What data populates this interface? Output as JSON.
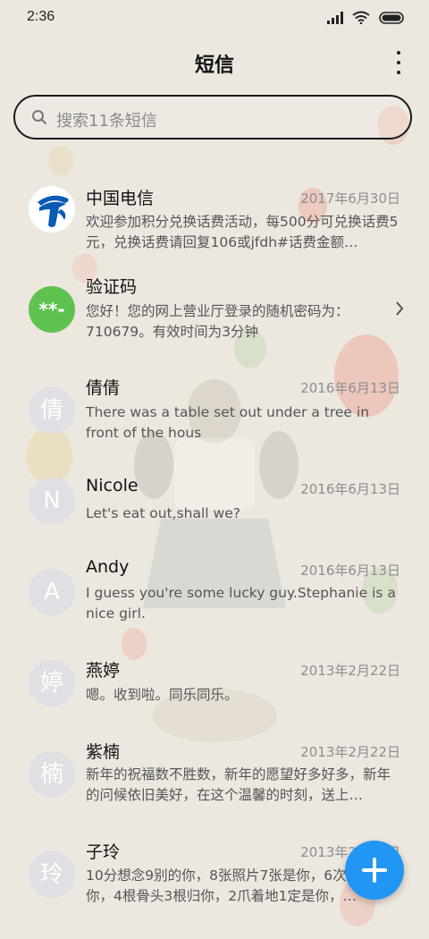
{
  "status_bar": {
    "time": "2:36"
  },
  "header": {
    "title": "短信"
  },
  "search": {
    "placeholder": "搜索11条短信"
  },
  "conversations": [
    {
      "name": "中国电信",
      "date": "2017年6月30日",
      "snippet": "欢迎参加积分兑换话费活动，每500分可兑换话费5元，兑换话费请回复106或jfdh#话费金额…",
      "avatar_type": "logo"
    },
    {
      "name": "验证码",
      "snippet": "您好！您的网上营业厅登录的随机密码为：710679。有效时间为3分钟",
      "avatar_text": "**-",
      "avatar_color": "#5ec24f"
    },
    {
      "name": "倩倩",
      "date": "2016年6月13日",
      "snippet": "There was a table set out under a tree in front of the hous",
      "avatar_text": "倩"
    },
    {
      "name": "Nicole",
      "date": "2016年6月13日",
      "snippet": "Let's eat out,shall we?",
      "avatar_text": "N"
    },
    {
      "name": "Andy",
      "date": "2016年6月13日",
      "snippet": "I guess you're some lucky guy.Stephanie is a nice girl.",
      "avatar_text": "A"
    },
    {
      "name": "燕婷",
      "date": "2013年2月22日",
      "snippet": "嗯。收到啦。同乐同乐。",
      "avatar_text": "婷"
    },
    {
      "name": "紫楠",
      "date": "2013年2月22日",
      "snippet": "新年的祝福数不胜数，新年的愿望好多好多，新年的问候依旧美好，在这个温馨的时刻，送上…",
      "avatar_text": "楠"
    },
    {
      "name": "子玲",
      "date": "2013年2月22日",
      "snippet": "10分想念9别的你，8张照片7张是你，6次…只像你，4根骨头3根归你，2爪着地1定是你，…",
      "avatar_text": "玲"
    }
  ],
  "colors": {
    "fab": "#2196f3",
    "verification_avatar": "#5ec24f",
    "telecom_blue": "#0a5bb5"
  }
}
